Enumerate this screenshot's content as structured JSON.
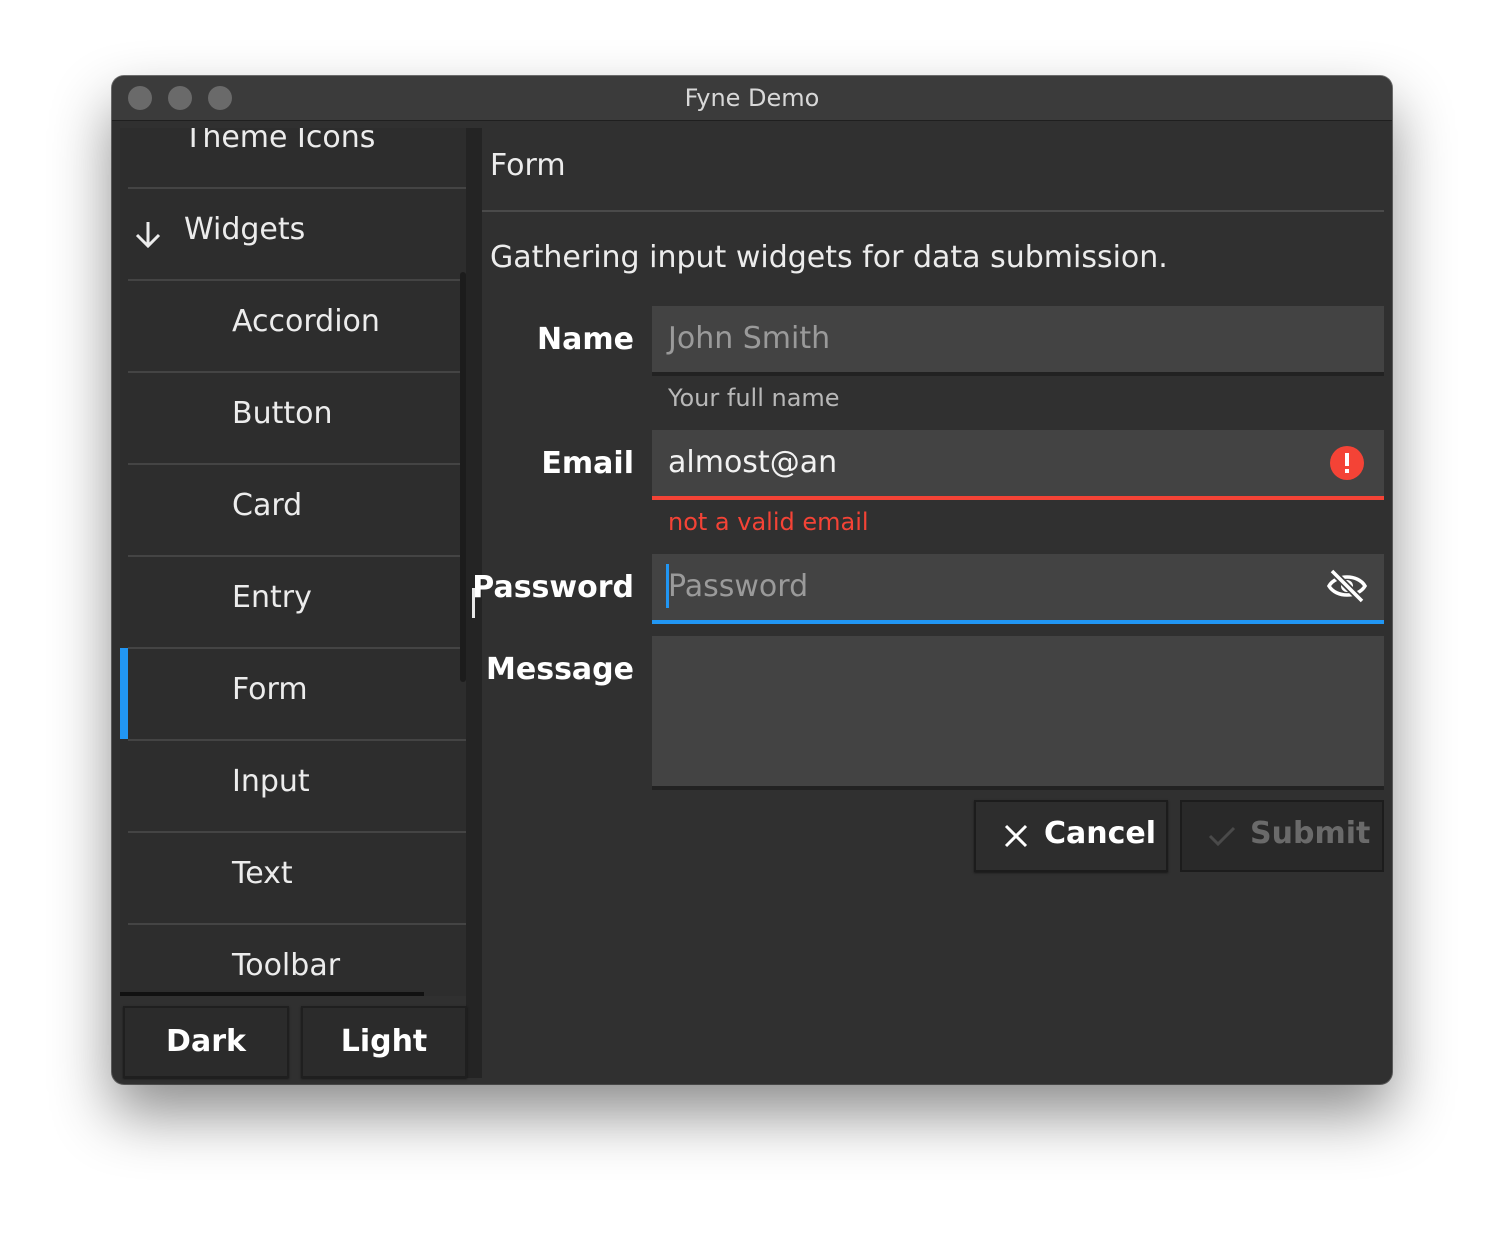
{
  "window": {
    "title": "Fyne Demo"
  },
  "sidebar": {
    "items": [
      {
        "label": "Theme Icons"
      },
      {
        "label": "Widgets",
        "expanded": true,
        "icon": "arrow-down-icon"
      },
      {
        "label": "Accordion"
      },
      {
        "label": "Button"
      },
      {
        "label": "Card"
      },
      {
        "label": "Entry"
      },
      {
        "label": "Form",
        "selected": true
      },
      {
        "label": "Input"
      },
      {
        "label": "Text"
      },
      {
        "label": "Toolbar"
      }
    ]
  },
  "theme_buttons": {
    "dark": "Dark",
    "light": "Light"
  },
  "content": {
    "title": "Form",
    "intro": "Gathering input widgets for data submission."
  },
  "form": {
    "name": {
      "label": "Name",
      "placeholder": "John Smith",
      "value": "",
      "hint": "Your full name"
    },
    "email": {
      "label": "Email",
      "value": "almost@an",
      "error": "not a valid email",
      "icon": "error-icon"
    },
    "password": {
      "label": "Password",
      "placeholder": "Password",
      "value": "",
      "icon": "eye-off-icon",
      "focused": true
    },
    "message": {
      "label": "Message",
      "value": ""
    }
  },
  "actions": {
    "cancel": {
      "label": "Cancel",
      "icon": "close-icon"
    },
    "submit": {
      "label": "Submit",
      "icon": "check-icon",
      "disabled": true
    }
  },
  "colors": {
    "accent": "#2196f3",
    "error": "#f44336",
    "background": "#303030",
    "input": "#434343",
    "text": "#ececec",
    "disabled_text": "#6a6a6a"
  }
}
